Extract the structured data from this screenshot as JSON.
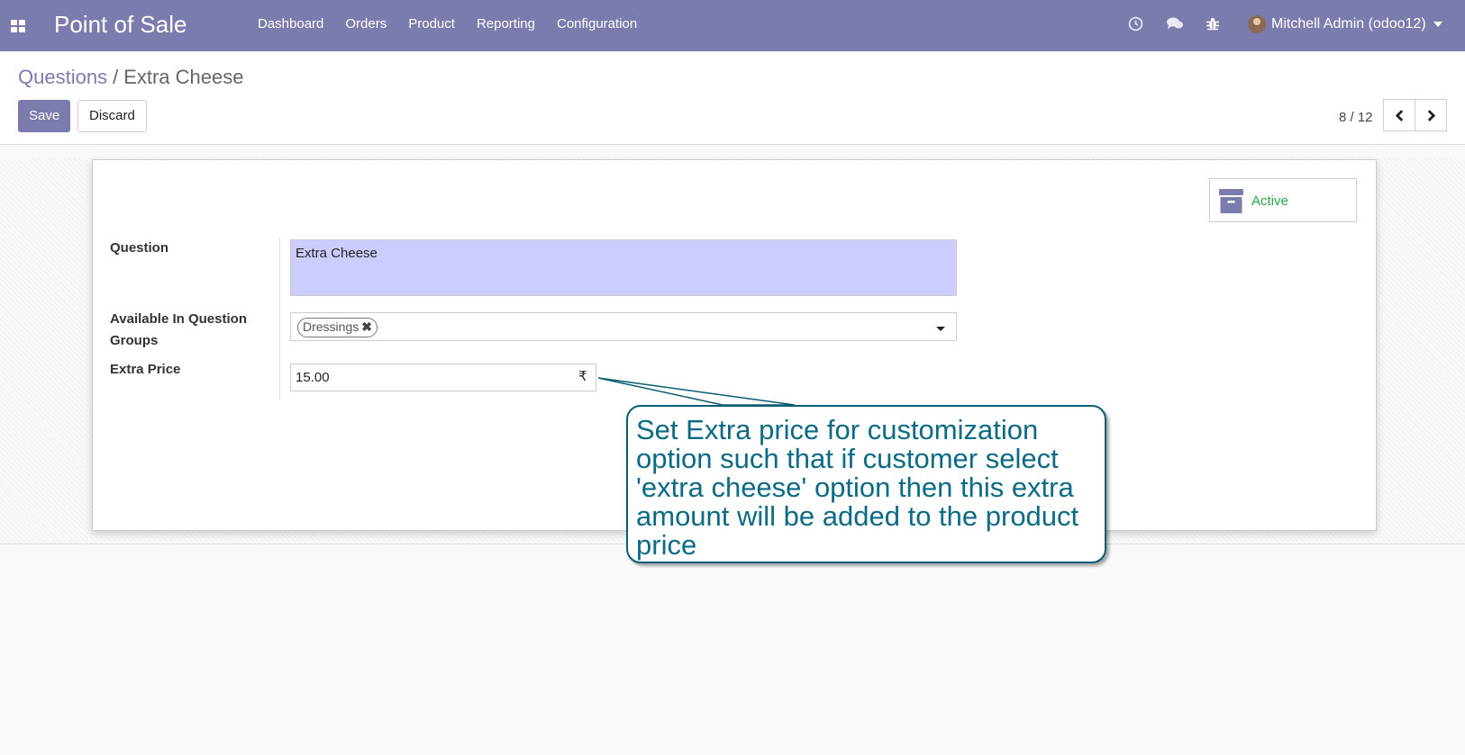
{
  "navbar": {
    "app_title": "Point of Sale",
    "menu": [
      "Dashboard",
      "Orders",
      "Product",
      "Reporting",
      "Configuration"
    ],
    "icons": [
      "apps-grid-icon",
      "clock-icon",
      "chat-icon",
      "bug-icon"
    ],
    "user": "Mitchell Admin (odoo12)",
    "color": "#7c7bad"
  },
  "breadcrumb": {
    "parent": "Questions",
    "separator": "/",
    "current": "Extra Cheese"
  },
  "buttons": {
    "save": "Save",
    "discard": "Discard"
  },
  "pager": {
    "value": "8 / 12"
  },
  "form": {
    "active_label": "Active",
    "question_label": "Question",
    "question_value": "Extra Cheese",
    "groups_label": "Available In Question Groups",
    "groups_tags": [
      "Dressings"
    ],
    "price_label": "Extra Price",
    "price_value": "15.00",
    "currency_symbol": "₹"
  },
  "annotation": {
    "text": "Set Extra price for customization option such that if customer select 'extra cheese' option then this extra amount will be added to the product price"
  }
}
